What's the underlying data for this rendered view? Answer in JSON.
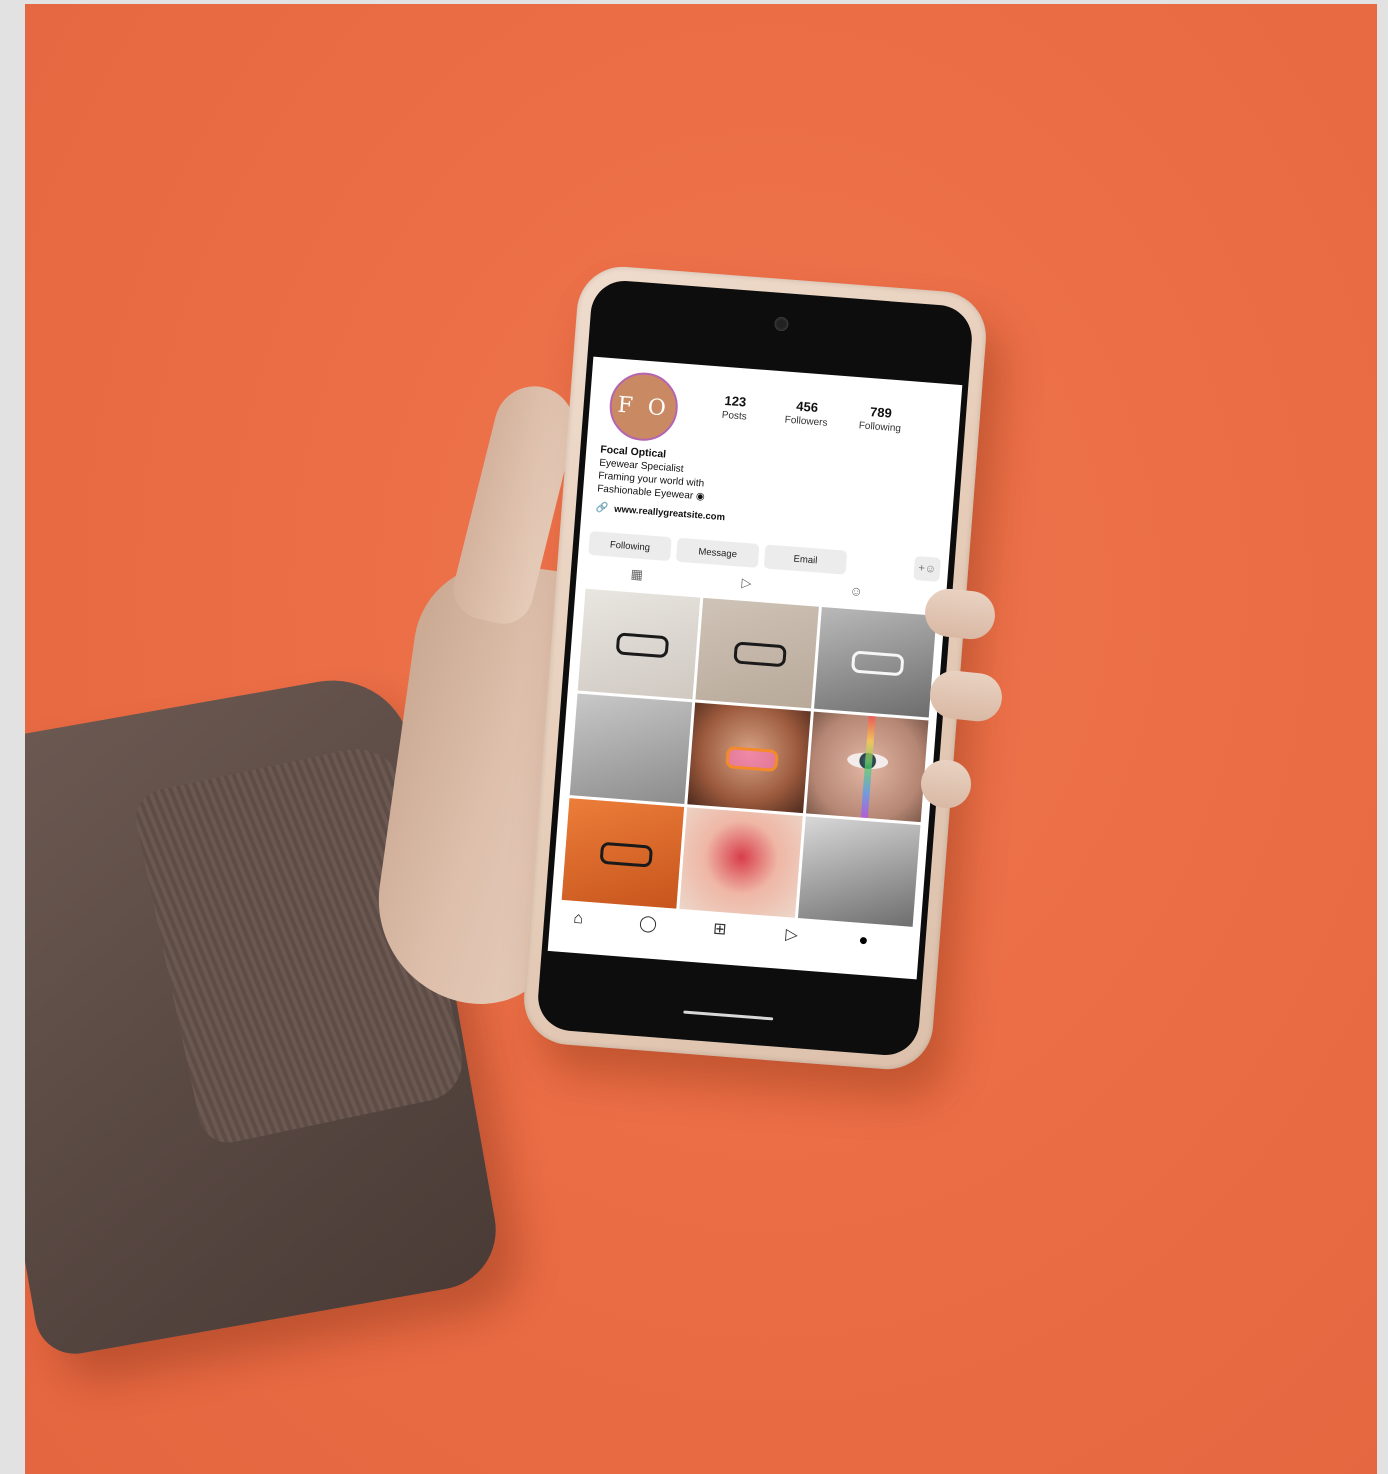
{
  "profile": {
    "avatar_initials": "F O",
    "stats": [
      {
        "value": "123",
        "label": "Posts"
      },
      {
        "value": "456",
        "label": "Followers"
      },
      {
        "value": "789",
        "label": "Following"
      }
    ],
    "name": "Focal Optical",
    "bio_line1": "Eyewear Specialist",
    "bio_line2": "Framing your world with",
    "bio_line3": "Fashionable Eyewear ◉",
    "website": "www.reallygreatsite.com"
  },
  "actions": {
    "following": "Following",
    "message": "Message",
    "email": "Email"
  },
  "icons": {
    "link": "🔗",
    "add_person": "+☺",
    "grid": "▦",
    "reels": "▷",
    "tagged": "☺",
    "home": "⌂",
    "search": "◯",
    "create": "⊞",
    "reels_nav": "▷",
    "profile": "●"
  },
  "colors": {
    "background": "#ea6c44",
    "avatar": "#c98a63",
    "case": "#e6cdb9",
    "sleeve": "#5b4a44"
  }
}
